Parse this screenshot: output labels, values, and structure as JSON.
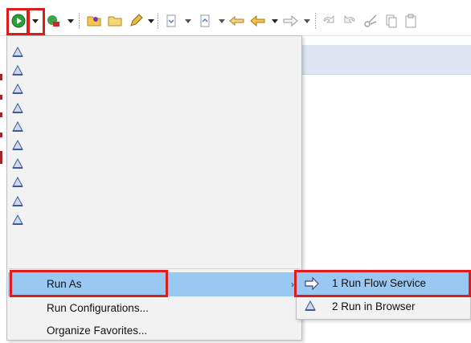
{
  "toolbar": {
    "icons": [
      "run-icon",
      "dropdown-arrow-icon",
      "debug-icon",
      "dropdown-arrow-icon",
      "open-folder-icon",
      "folder-icon",
      "pencil-icon",
      "dropdown-arrow-icon",
      "next-annotation-icon",
      "dropdown-arrow-icon",
      "previous-annotation-icon",
      "dropdown-arrow-icon",
      "back-icon",
      "back-arrow-icon",
      "dropdown-arrow-icon",
      "forward-arrow-icon",
      "dropdown-arrow-icon",
      "undo-icon",
      "redo-icon",
      "cut-icon",
      "copy-icon",
      "paste-icon"
    ]
  },
  "menu": {
    "favorites_icon": "run-config-icon",
    "favorites_count": 10,
    "items": [
      {
        "label": "Run As",
        "has_submenu": true,
        "selected": true
      },
      {
        "label": "Run Configurations...",
        "has_submenu": false,
        "selected": false
      },
      {
        "label": "Organize Favorites...",
        "has_submenu": false,
        "selected": false
      }
    ],
    "submenu_arrow": "›"
  },
  "submenu": {
    "items": [
      {
        "label": "1 Run Flow Service",
        "icon": "flow-arrow-icon",
        "selected": true
      },
      {
        "label": "2 Run in Browser",
        "icon": "run-config-icon",
        "selected": false
      }
    ]
  },
  "colors": {
    "highlight": "#e01b1b",
    "selection": "#99c9f2",
    "menu_bg": "#f2f2f2"
  }
}
